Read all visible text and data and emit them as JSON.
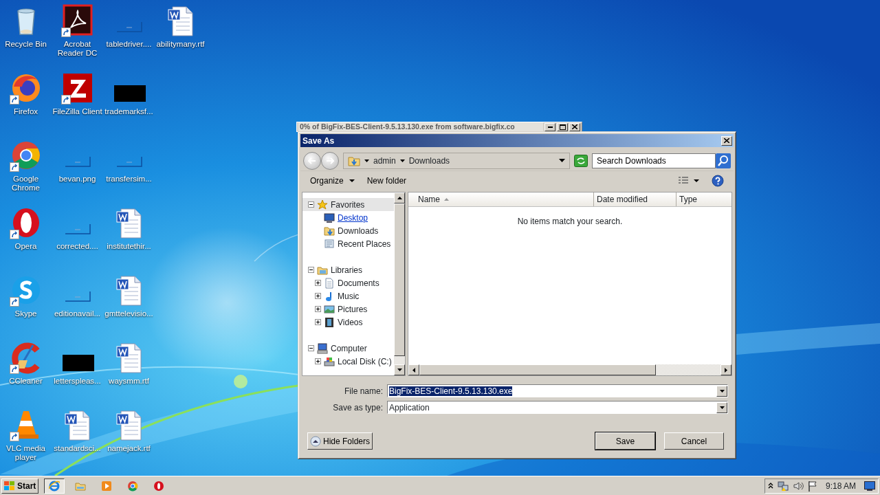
{
  "desktop": {
    "columns": [
      [
        {
          "label": "Recycle Bin",
          "kind": "recycle",
          "shortcut": false
        },
        {
          "label": "Firefox",
          "kind": "firefox",
          "shortcut": true
        },
        {
          "label": "Google Chrome",
          "kind": "chrome",
          "shortcut": true
        },
        {
          "label": "Opera",
          "kind": "opera",
          "shortcut": true
        },
        {
          "label": "Skype",
          "kind": "skype",
          "shortcut": true
        },
        {
          "label": "CCleaner",
          "kind": "ccleaner",
          "shortcut": true
        },
        {
          "label": "VLC media player",
          "kind": "vlc",
          "shortcut": true
        }
      ],
      [
        {
          "label": "Acrobat Reader DC",
          "kind": "acrobat",
          "shortcut": true
        },
        {
          "label": "FileZilla Client",
          "kind": "filezilla",
          "shortcut": true
        },
        {
          "label": "bevan.png",
          "kind": "blank",
          "shortcut": false
        },
        {
          "label": "corrected....",
          "kind": "blank",
          "shortcut": false
        },
        {
          "label": "editionavail...",
          "kind": "blank",
          "shortcut": false
        },
        {
          "label": "letterspleas...",
          "kind": "black",
          "shortcut": false
        },
        {
          "label": "standardsci...",
          "kind": "word",
          "shortcut": false
        }
      ],
      [
        {
          "label": "tabledriver....",
          "kind": "blank",
          "shortcut": false
        },
        {
          "label": "trademarksf...",
          "kind": "black",
          "shortcut": false
        },
        {
          "label": "transfersim...",
          "kind": "blank",
          "shortcut": false
        },
        {
          "label": "institutethir...",
          "kind": "word",
          "shortcut": false
        },
        {
          "label": "gmttelevisio...",
          "kind": "word",
          "shortcut": false
        },
        {
          "label": "waysmm.rtf",
          "kind": "word",
          "shortcut": false
        },
        {
          "label": "namejack.rtf",
          "kind": "word",
          "shortcut": false
        }
      ],
      [
        {
          "label": "abilitymany.rtf",
          "kind": "word",
          "shortcut": false
        }
      ]
    ]
  },
  "background_window": {
    "title": "0% of BigFix-BES-Client-9.5.13.130.exe from software.bigfix.co"
  },
  "dialog": {
    "title": "Save As",
    "address": {
      "segments": [
        "admin",
        "Downloads"
      ]
    },
    "search": {
      "placeholder": "Search Downloads"
    },
    "toolbar": {
      "organize": "Organize",
      "new_folder": "New folder"
    },
    "tree": [
      {
        "label": "Favorites",
        "kind": "star",
        "expanded": true,
        "selected": true,
        "hovered": false,
        "children": [
          {
            "label": "Desktop",
            "kind": "desktop",
            "selected": false,
            "hovered": true
          },
          {
            "label": "Downloads",
            "kind": "downloads",
            "selected": false,
            "hovered": false
          },
          {
            "label": "Recent Places",
            "kind": "recent",
            "selected": false,
            "hovered": false
          }
        ]
      },
      {
        "label": "Libraries",
        "kind": "libraries",
        "expanded": true,
        "selected": false,
        "hovered": false,
        "children": [
          {
            "label": "Documents",
            "kind": "documents",
            "expanded": false,
            "selected": false,
            "hovered": false
          },
          {
            "label": "Music",
            "kind": "music",
            "expanded": false,
            "selected": false,
            "hovered": false
          },
          {
            "label": "Pictures",
            "kind": "pictures",
            "expanded": false,
            "selected": false,
            "hovered": false
          },
          {
            "label": "Videos",
            "kind": "videos",
            "expanded": false,
            "selected": false,
            "hovered": false
          }
        ]
      },
      {
        "label": "Computer",
        "kind": "computer",
        "expanded": true,
        "selected": false,
        "hovered": false,
        "children": [
          {
            "label": "Local Disk (C:)",
            "kind": "disk",
            "expanded": false,
            "selected": false,
            "hovered": false
          }
        ]
      }
    ],
    "columns": [
      {
        "label": "Name",
        "sorted": true
      },
      {
        "label": "Date modified",
        "sorted": false
      },
      {
        "label": "Type",
        "sorted": false
      }
    ],
    "empty_message": "No items match your search.",
    "file_name": {
      "label": "File name:",
      "value": "BigFix-BES-Client-9.5.13.130.exe"
    },
    "save_as_type": {
      "label": "Save as type:",
      "value": "Application"
    },
    "hide_folders": "Hide Folders",
    "buttons": [
      {
        "label": "Save",
        "default": true
      },
      {
        "label": "Cancel",
        "default": false
      }
    ]
  },
  "taskbar": {
    "start": "Start",
    "apps": [
      {
        "kind": "ie",
        "active": true
      },
      {
        "kind": "explorer",
        "active": false
      },
      {
        "kind": "media",
        "active": false
      },
      {
        "kind": "chrome",
        "active": false
      },
      {
        "kind": "opera",
        "active": false
      }
    ],
    "clock": "9:18 AM"
  }
}
